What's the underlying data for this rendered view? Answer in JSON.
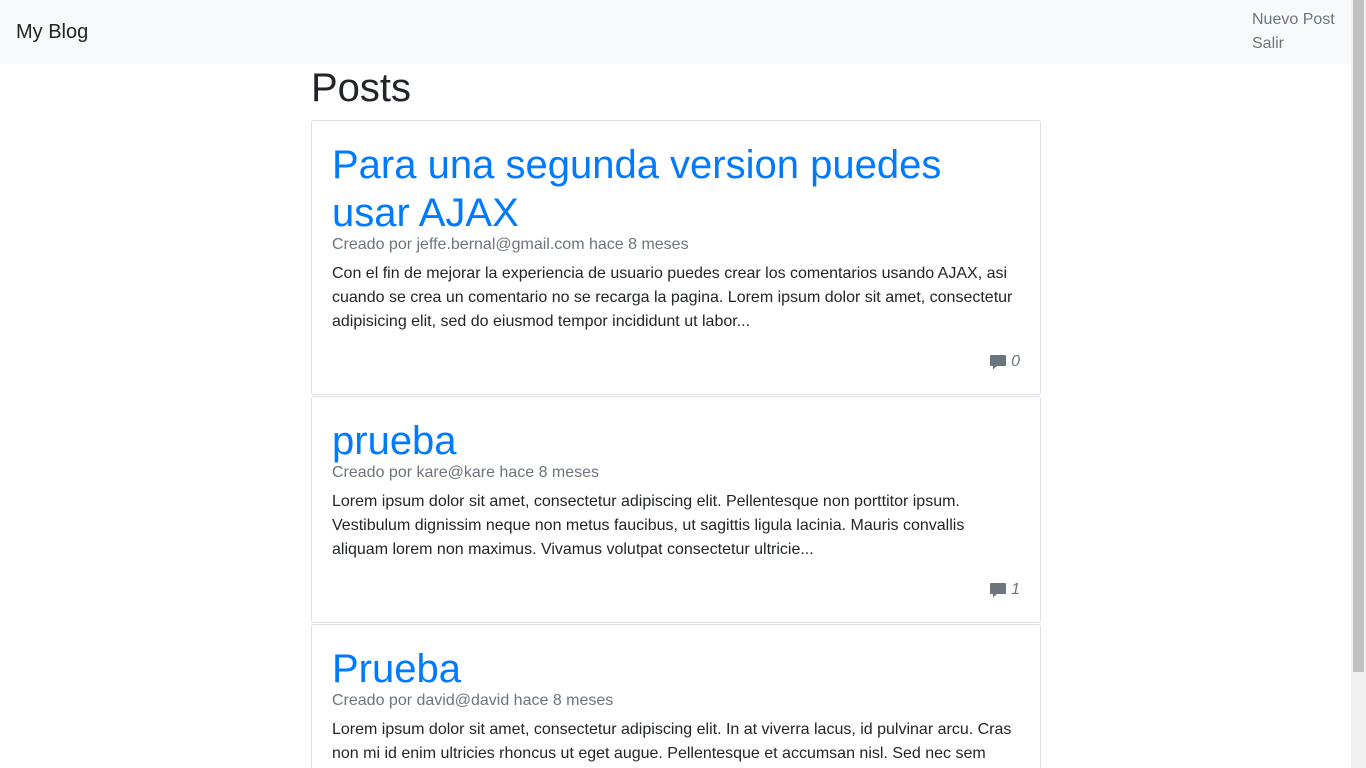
{
  "navbar": {
    "brand": "My Blog",
    "links": [
      "Nuevo Post",
      "Salir"
    ]
  },
  "main": {
    "title": "Posts",
    "posts": [
      {
        "title": "Para una segunda version puedes usar AJAX",
        "meta": "Creado por jeffe.bernal@gmail.com hace 8 meses",
        "excerpt": "Con el fin de mejorar la experiencia de usuario puedes crear los comentarios usando AJAX, asi cuando se crea un comentario no se recarga la pagina. Lorem ipsum dolor sit amet, consectetur adipisicing elit, sed do eiusmod tempor incididunt ut labor...",
        "comments": "0"
      },
      {
        "title": "prueba",
        "meta": "Creado por kare@kare hace 8 meses",
        "excerpt": "Lorem ipsum dolor sit amet, consectetur adipiscing elit. Pellentesque non porttitor ipsum. Vestibulum dignissim neque non metus faucibus, ut sagittis ligula lacinia. Mauris convallis aliquam lorem non maximus. Vivamus volutpat consectetur ultricie...",
        "comments": "1"
      },
      {
        "title": "Prueba",
        "meta": "Creado por david@david hace 8 meses",
        "excerpt": "Lorem ipsum dolor sit amet, consectetur adipiscing elit. In at viverra lacus, id pulvinar arcu. Cras non mi id enim ultricies rhoncus ut eget augue. Pellentesque et accumsan nisl. Sed nec sem",
        "comments": ""
      }
    ]
  },
  "icons": {
    "comment": "comment-icon"
  },
  "colors": {
    "link": "#007bff",
    "muted": "#6c757d",
    "navbar_bg": "#f8f9fa"
  }
}
